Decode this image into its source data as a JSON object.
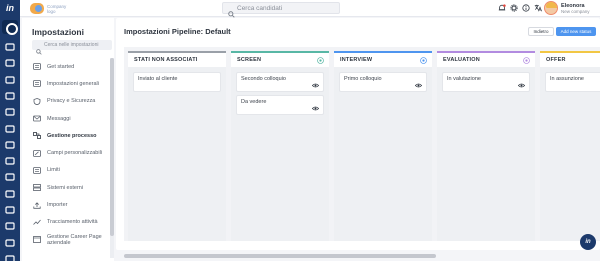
{
  "app": {
    "logo_text": "in",
    "brand_line1": "Company",
    "brand_line2": "logo"
  },
  "topbar": {
    "search_placeholder": "Cerca candidati",
    "user_name": "Eleonora",
    "user_company": "New company"
  },
  "rail": {
    "icons": [
      "home-icon",
      "users-icon",
      "person-icon",
      "chart-icon",
      "bank-icon",
      "briefcase-icon",
      "folder-icon",
      "alert-icon",
      "truck-icon",
      "calendar-icon",
      "mail-icon",
      "calendar-icon",
      "calendar-icon",
      "export-icon"
    ]
  },
  "settings": {
    "title": "Impostazioni",
    "search_placeholder": "Cerca nelle impostazioni",
    "items": [
      {
        "label": "Get started",
        "icon": "list-icon"
      },
      {
        "label": "Impostazioni generali",
        "icon": "list-icon"
      },
      {
        "label": "Privacy e Sicurezza",
        "icon": "shield-icon"
      },
      {
        "label": "Messaggi",
        "icon": "mail-icon"
      },
      {
        "label": "Gestione processo",
        "icon": "process-icon"
      },
      {
        "label": "Campi personalizzabili",
        "icon": "edit-icon"
      },
      {
        "label": "Limiti",
        "icon": "list-icon"
      },
      {
        "label": "Sistemi esterni",
        "icon": "server-icon"
      },
      {
        "label": "Importer",
        "icon": "upload-icon"
      },
      {
        "label": "Tracciamento attività",
        "icon": "track-icon"
      },
      {
        "label": "Gestione Career Page aziendale",
        "icon": "page-icon"
      }
    ],
    "active_index": 4
  },
  "main": {
    "title": "Impostazioni Pipeline: Default",
    "back_label": "Indietro",
    "add_label": "Add new status"
  },
  "pipeline": {
    "columns": [
      {
        "title": "STATI NON ASSOCIATI",
        "color": "#9aa0a8",
        "has_gear": false,
        "cards": [
          "Inviato al cliente"
        ]
      },
      {
        "title": "SCREEN",
        "color": "#58b7a5",
        "has_gear": true,
        "cards": [
          "Secondo colloquio",
          "Da vedere"
        ]
      },
      {
        "title": "INTERVIEW",
        "color": "#4e95ef",
        "has_gear": true,
        "cards": [
          "Primo colloquio"
        ]
      },
      {
        "title": "EVALUATION",
        "color": "#b28be0",
        "has_gear": true,
        "cards": [
          "In valutazione"
        ]
      },
      {
        "title": "OFFER",
        "color": "#f2c744",
        "has_gear": false,
        "cards": [
          "In assunzione"
        ]
      }
    ]
  },
  "fab": {
    "label": "in"
  }
}
